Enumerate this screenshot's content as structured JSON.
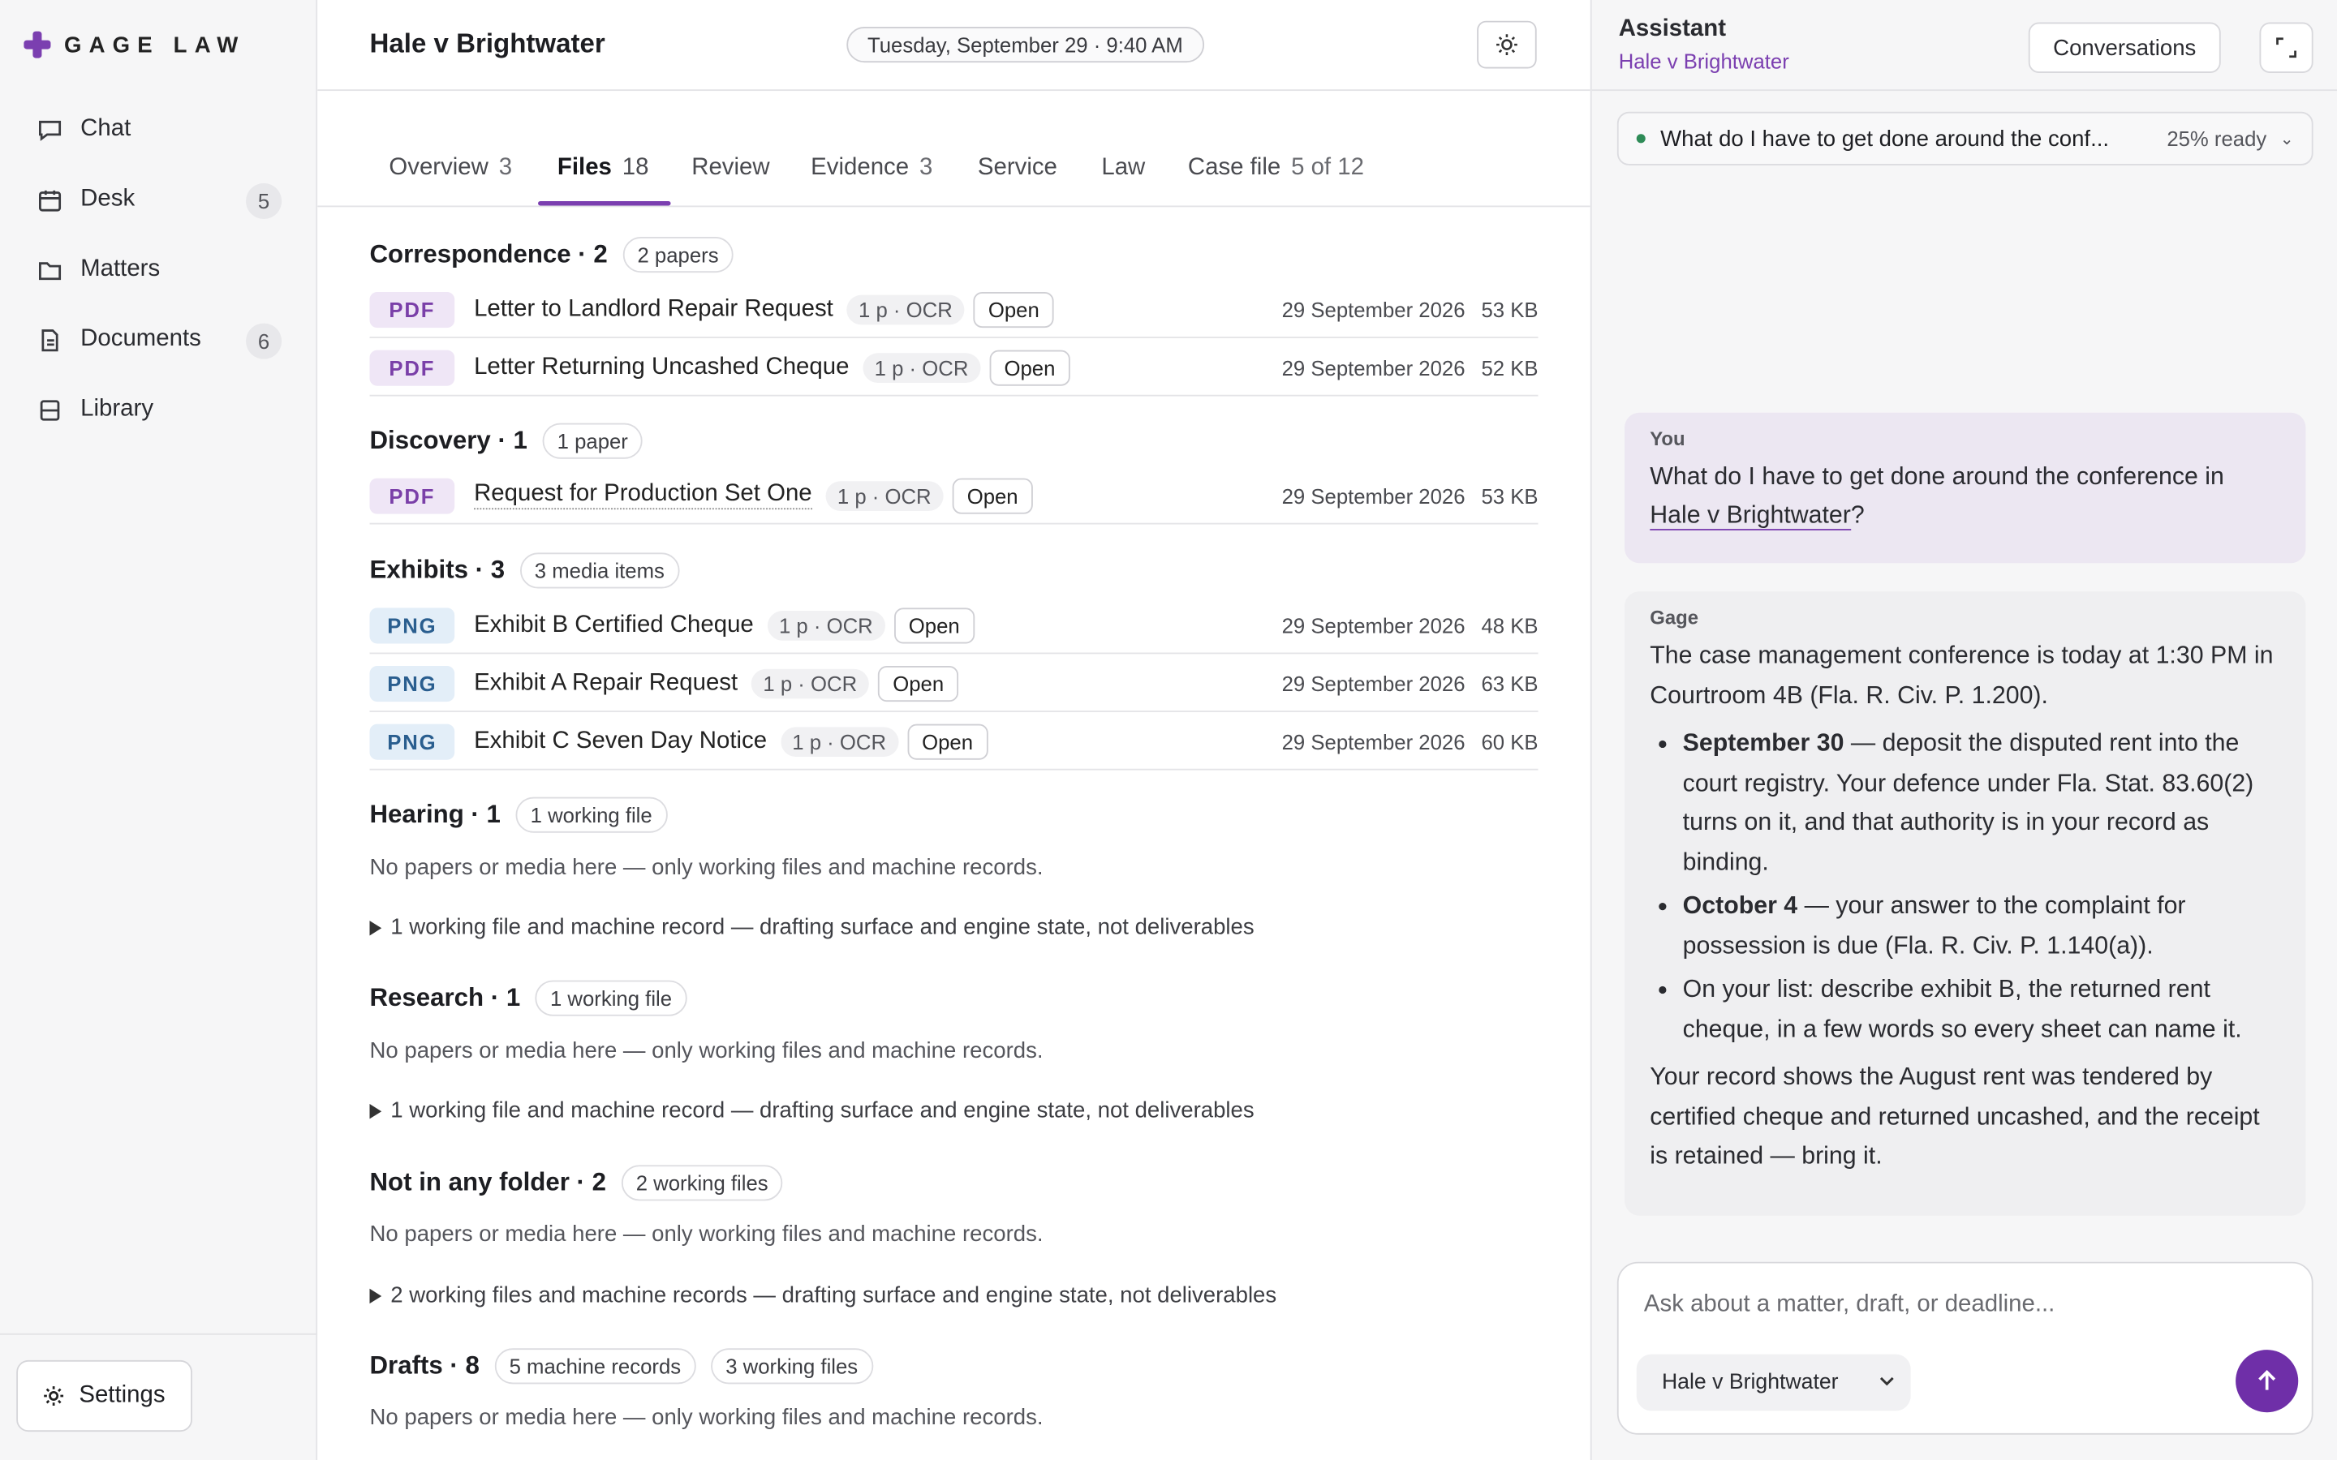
{
  "brand": {
    "name": "GAGE LAW"
  },
  "sidebar": {
    "items": [
      {
        "label": "Chat",
        "icon": "chat-bubble-icon",
        "badge": ""
      },
      {
        "label": "Desk",
        "icon": "calendar-icon",
        "badge": "5"
      },
      {
        "label": "Matters",
        "icon": "folder-icon",
        "badge": ""
      },
      {
        "label": "Documents",
        "icon": "document-icon",
        "badge": "6"
      },
      {
        "label": "Library",
        "icon": "book-icon",
        "badge": ""
      }
    ],
    "settings_label": "Settings"
  },
  "header": {
    "title": "Hale v Brightwater",
    "datetime": "Tuesday, September 29 · 9:40 AM"
  },
  "tabs": [
    {
      "label": "Overview",
      "count": "3"
    },
    {
      "label": "Files",
      "count": "18"
    },
    {
      "label": "Review",
      "count": ""
    },
    {
      "label": "Evidence",
      "count": "3"
    },
    {
      "label": "Service",
      "count": ""
    },
    {
      "label": "Law",
      "count": ""
    },
    {
      "label": "Case file",
      "count": "5 of 12"
    }
  ],
  "files": {
    "correspondence": {
      "title": "Correspondence · 2",
      "chip": "2 papers",
      "rows": [
        {
          "type": "PDF",
          "name": "Letter to Landlord Repair Request",
          "ocr": "1 p · OCR",
          "open": "Open",
          "date": "29 September 2026",
          "size": "53 KB"
        },
        {
          "type": "PDF",
          "name": "Letter Returning Uncashed Cheque",
          "ocr": "1 p · OCR",
          "open": "Open",
          "date": "29 September 2026",
          "size": "52 KB"
        }
      ]
    },
    "discovery": {
      "title": "Discovery · 1",
      "chip": "1 paper",
      "rows": [
        {
          "type": "PDF",
          "name": "Request for Production Set One",
          "ocr": "1 p · OCR",
          "open": "Open",
          "date": "29 September 2026",
          "size": "53 KB"
        }
      ]
    },
    "exhibits": {
      "title": "Exhibits · 3",
      "chip": "3 media items",
      "rows": [
        {
          "type": "PNG",
          "name": "Exhibit B Certified Cheque",
          "ocr": "1 p · OCR",
          "open": "Open",
          "date": "29 September 2026",
          "size": "48 KB"
        },
        {
          "type": "PNG",
          "name": "Exhibit A Repair Request",
          "ocr": "1 p · OCR",
          "open": "Open",
          "date": "29 September 2026",
          "size": "63 KB"
        },
        {
          "type": "PNG",
          "name": "Exhibit C Seven Day Notice",
          "ocr": "1 p · OCR",
          "open": "Open",
          "date": "29 September 2026",
          "size": "60 KB"
        }
      ]
    },
    "hearing": {
      "title": "Hearing · 1",
      "chip": "1 working file",
      "note": "No papers or media here — only working files and machine records.",
      "disclosure": "1 working file and machine record — drafting surface and engine state, not deliverables"
    },
    "research": {
      "title": "Research · 1",
      "chip": "1 working file",
      "note": "No papers or media here — only working files and machine records.",
      "disclosure": "1 working file and machine record — drafting surface and engine state, not deliverables"
    },
    "none": {
      "title": "Not in any folder · 2",
      "chip": "2 working files",
      "note": "No papers or media here — only working files and machine records.",
      "disclosure": "2 working files and machine records — drafting surface and engine state, not deliverables"
    },
    "drafts": {
      "title": "Drafts · 8",
      "chip1": "5 machine records",
      "chip2": "3 working files",
      "note": "No papers or media here — only working files and machine records."
    }
  },
  "assistant": {
    "title": "Assistant",
    "subtitle": "Hale v Brightwater",
    "conversations_label": "Conversations",
    "conversation": {
      "question": "What do I have to get done around the conf...",
      "status": "25% ready"
    },
    "you": {
      "who": "You",
      "text_before": "What do I have to get done around the conference in ",
      "link": "Hale v Brightwater",
      "text_after": "?"
    },
    "gage": {
      "who": "Gage",
      "intro": "The case management conference is today at 1:30 PM in Courtroom 4B (Fla. R. Civ. P. 1.200).",
      "items": [
        {
          "bold": "September 30",
          "text": " — deposit the disputed rent into the court registry. Your defence under Fla. Stat. 83.60(2) turns on it, and that authority is in your record as binding."
        },
        {
          "bold": "October 4",
          "text": " — your answer to the complaint for possession is due (Fla. R. Civ. P. 1.140(a))."
        },
        {
          "bold": "",
          "text": "On your list: describe exhibit B, the returned rent cheque, in a few words so every sheet can name it."
        }
      ],
      "outro": "Your record shows the August rent was tendered by certified cheque and returned uncashed, and the receipt is retained — bring it."
    },
    "composer": {
      "placeholder": "Ask about a matter, draft, or deadline...",
      "matter": "Hale v Brightwater"
    }
  },
  "colors": {
    "accent": "#7b3fb0",
    "send": "#6f2fa8",
    "pdf": "#7a3fa8",
    "png": "#2a5e8f"
  }
}
